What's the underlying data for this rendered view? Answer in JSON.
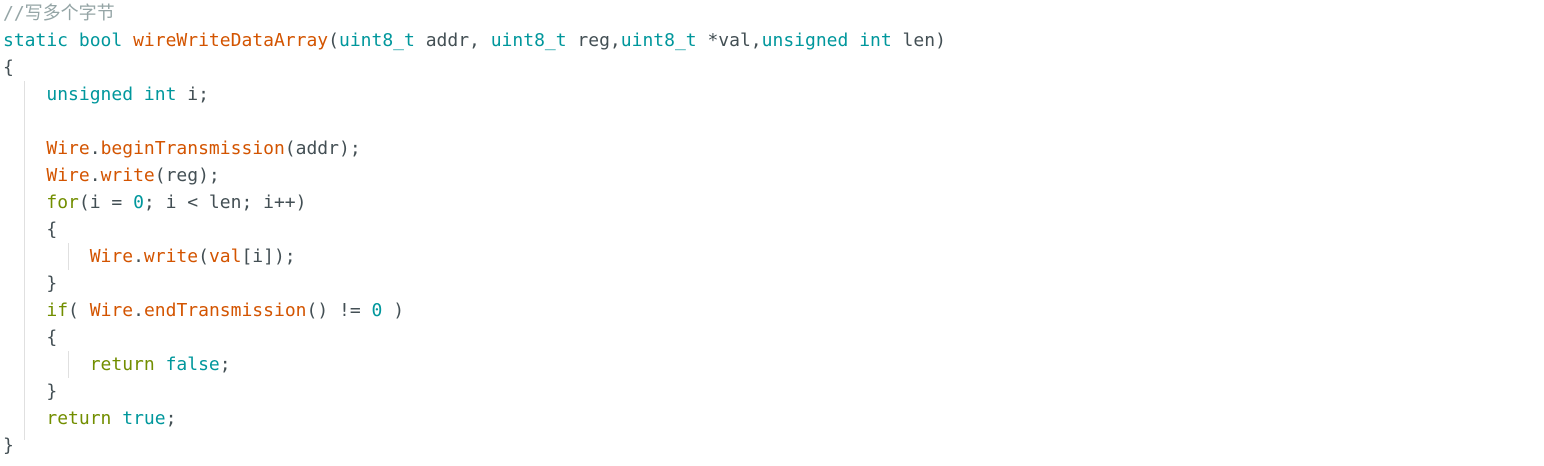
{
  "colors": {
    "background": "#ffffff",
    "comment": "#95a5a6",
    "keyword": "#00979c",
    "function": "#d35400",
    "control": "#728e00",
    "text": "#434f54",
    "indent_guide": "#e0e0e0"
  },
  "code_lines": [
    [
      {
        "t": "//写多个字节",
        "k": "comment"
      }
    ],
    [
      {
        "t": "static",
        "k": "keyword"
      },
      {
        "t": " ",
        "k": "text"
      },
      {
        "t": "bool",
        "k": "keyword"
      },
      {
        "t": " ",
        "k": "text"
      },
      {
        "t": "wireWriteDataArray",
        "k": "function"
      },
      {
        "t": "(",
        "k": "text"
      },
      {
        "t": "uint8_t",
        "k": "keyword"
      },
      {
        "t": " addr, ",
        "k": "text"
      },
      {
        "t": "uint8_t",
        "k": "keyword"
      },
      {
        "t": " reg,",
        "k": "text"
      },
      {
        "t": "uint8_t",
        "k": "keyword"
      },
      {
        "t": " *val,",
        "k": "text"
      },
      {
        "t": "unsigned",
        "k": "keyword"
      },
      {
        "t": " ",
        "k": "text"
      },
      {
        "t": "int",
        "k": "keyword"
      },
      {
        "t": " len)",
        "k": "text"
      }
    ],
    [
      {
        "t": "{",
        "k": "text"
      }
    ],
    [
      {
        "t": "    ",
        "k": "text"
      },
      {
        "t": "unsigned",
        "k": "keyword"
      },
      {
        "t": " ",
        "k": "text"
      },
      {
        "t": "int",
        "k": "keyword"
      },
      {
        "t": " i;",
        "k": "text"
      }
    ],
    [
      {
        "t": "",
        "k": "text"
      }
    ],
    [
      {
        "t": "    ",
        "k": "text"
      },
      {
        "t": "Wire",
        "k": "function"
      },
      {
        "t": ".",
        "k": "text"
      },
      {
        "t": "beginTransmission",
        "k": "function"
      },
      {
        "t": "(addr);",
        "k": "text"
      }
    ],
    [
      {
        "t": "    ",
        "k": "text"
      },
      {
        "t": "Wire",
        "k": "function"
      },
      {
        "t": ".",
        "k": "text"
      },
      {
        "t": "write",
        "k": "function"
      },
      {
        "t": "(reg);",
        "k": "text"
      }
    ],
    [
      {
        "t": "    ",
        "k": "text"
      },
      {
        "t": "for",
        "k": "control"
      },
      {
        "t": "(i = ",
        "k": "text"
      },
      {
        "t": "0",
        "k": "keyword"
      },
      {
        "t": "; i < len; i++)",
        "k": "text"
      }
    ],
    [
      {
        "t": "    {",
        "k": "text"
      }
    ],
    [
      {
        "t": "        ",
        "k": "text"
      },
      {
        "t": "Wire",
        "k": "function"
      },
      {
        "t": ".",
        "k": "text"
      },
      {
        "t": "write",
        "k": "function"
      },
      {
        "t": "(",
        "k": "text"
      },
      {
        "t": "val",
        "k": "function"
      },
      {
        "t": "[i]);",
        "k": "text"
      }
    ],
    [
      {
        "t": "    }",
        "k": "text"
      }
    ],
    [
      {
        "t": "    ",
        "k": "text"
      },
      {
        "t": "if",
        "k": "control"
      },
      {
        "t": "( ",
        "k": "text"
      },
      {
        "t": "Wire",
        "k": "function"
      },
      {
        "t": ".",
        "k": "text"
      },
      {
        "t": "endTransmission",
        "k": "function"
      },
      {
        "t": "() != ",
        "k": "text"
      },
      {
        "t": "0",
        "k": "keyword"
      },
      {
        "t": " )",
        "k": "text"
      }
    ],
    [
      {
        "t": "    {",
        "k": "text"
      }
    ],
    [
      {
        "t": "        ",
        "k": "text"
      },
      {
        "t": "return",
        "k": "control"
      },
      {
        "t": " ",
        "k": "text"
      },
      {
        "t": "false",
        "k": "keyword"
      },
      {
        "t": ";",
        "k": "text"
      }
    ],
    [
      {
        "t": "    }",
        "k": "text"
      }
    ],
    [
      {
        "t": "    ",
        "k": "text"
      },
      {
        "t": "return",
        "k": "control"
      },
      {
        "t": " ",
        "k": "text"
      },
      {
        "t": "true",
        "k": "keyword"
      },
      {
        "t": ";",
        "k": "text"
      }
    ],
    [
      {
        "t": "}",
        "k": "text"
      }
    ]
  ]
}
